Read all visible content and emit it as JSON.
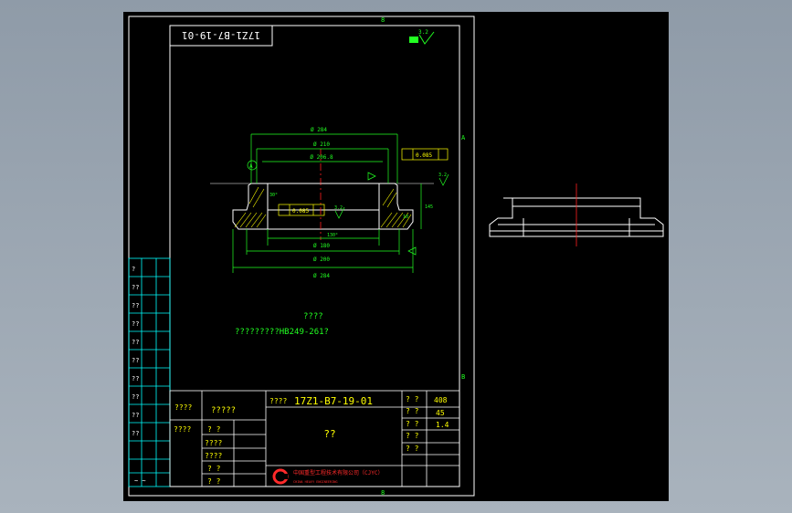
{
  "drawing": {
    "number_top": "17Z1-B7-19-01",
    "surface_roughness": "3.2",
    "dims": {
      "d284": "Ø 284",
      "d210": "Ø 210",
      "d2068": "Ø 206.8",
      "tol_0085": "0.085",
      "rough_32a": "3.2",
      "rough_32b": "3.2",
      "d180": "Ø 180",
      "d200": "Ø 200",
      "d284_bottom": "Ø 284",
      "angle_a": "30°",
      "angle_b": "130°",
      "depth": "145",
      "depth2": "10"
    },
    "note_title": "????",
    "note_text": "?????????HB249-261?",
    "datum_a": "A"
  },
  "title_block": {
    "drawing_no": "17Z1-B7-19-01",
    "part_name": "??",
    "cell_a": "????",
    "cell_b": "?????",
    "cell_c": "????",
    "cell_d": "????",
    "cell_e": "? ?",
    "cell_f": "????",
    "cell_g": "????",
    "cell_h": "? ?",
    "cell_i": "? ?",
    "q1": "? ?",
    "q2": "? ?",
    "q3": "? ?",
    "q4": "? ?",
    "q5": "? ?",
    "v1": "408",
    "v2": "45",
    "v3": "1.4",
    "company": "中国重型工程技术有限公司（CJYC）",
    "company_en": "CHINA HEAVY ENGINEERING",
    "bottom_mark": "~ ~"
  },
  "sidebar_labels": [
    "?",
    "??",
    "??",
    "??",
    "??",
    "??",
    "??",
    "??",
    "??",
    "??"
  ],
  "border_marks": {
    "top": "8",
    "bottom": "8",
    "right_a": "A",
    "right_b": "B"
  },
  "colors": {
    "frame": "#ffffff",
    "green": "#22ff22",
    "cyan": "#00ffff",
    "yellow": "#ffff00",
    "red": "#ff2020",
    "logo": "#ff2a2a"
  }
}
